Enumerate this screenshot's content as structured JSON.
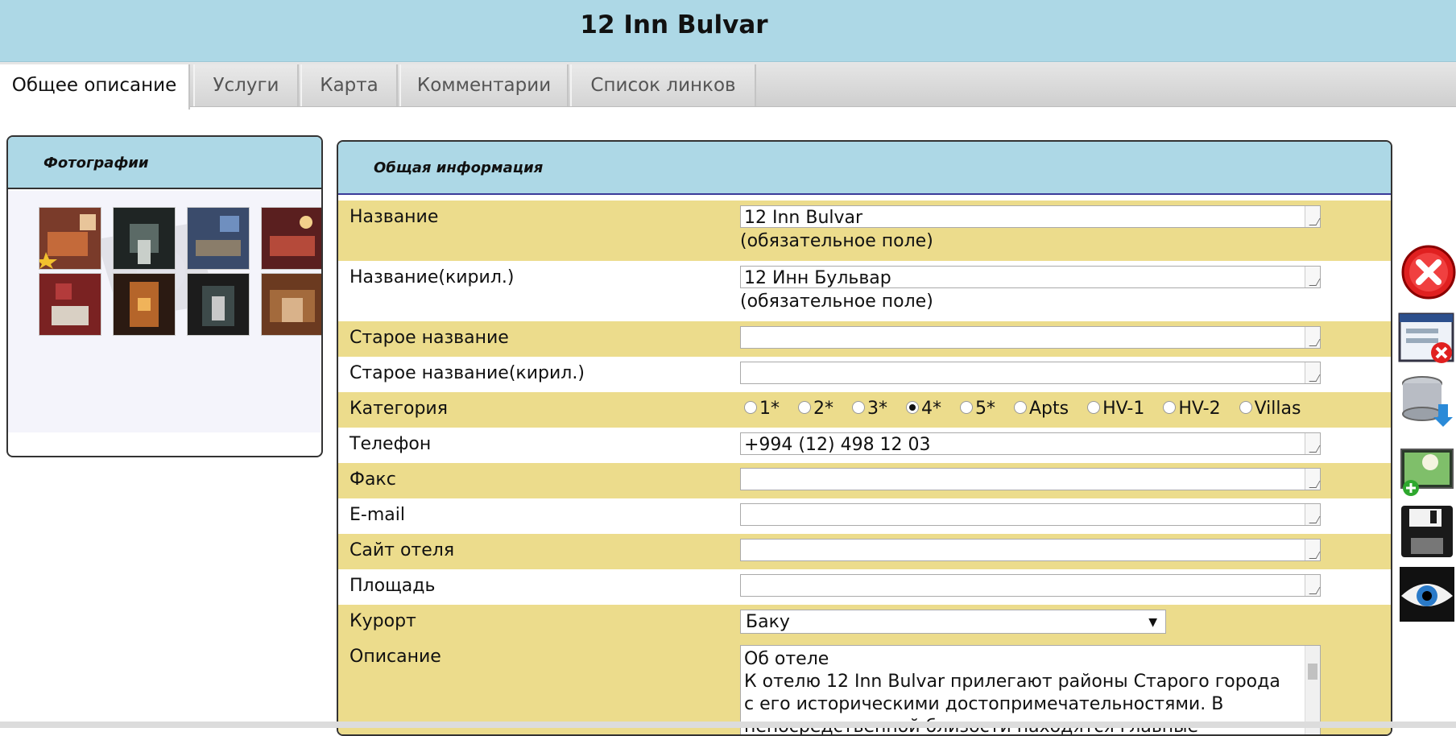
{
  "header": {
    "title": "12 Inn Bulvar"
  },
  "tabs": [
    {
      "label": "Общее описание",
      "active": true
    },
    {
      "label": "Услуги",
      "active": false
    },
    {
      "label": "Карта",
      "active": false
    },
    {
      "label": "Комментарии",
      "active": false
    },
    {
      "label": "Список линков",
      "active": false
    }
  ],
  "photos_panel": {
    "title": "Фотографии",
    "thumbnails": [
      "photo-1",
      "photo-2",
      "photo-3",
      "photo-4",
      "photo-5",
      "photo-6",
      "photo-7",
      "photo-8"
    ]
  },
  "info_panel": {
    "title": "Общая информация",
    "fields": {
      "name": {
        "label": "Название",
        "value": "12 Inn Bulvar",
        "note": "(обязательное поле)"
      },
      "name_cyr": {
        "label": "Название(кирил.)",
        "value": "12 Инн Бульвар",
        "note": "(обязательное поле)"
      },
      "old_name": {
        "label": "Старое название",
        "value": ""
      },
      "old_name_cyr": {
        "label": "Старое название(кирил.)",
        "value": ""
      },
      "category": {
        "label": "Категория",
        "options": [
          "1*",
          "2*",
          "3*",
          "4*",
          "5*",
          "Apts",
          "HV-1",
          "HV-2",
          "Villas"
        ],
        "selected": "4*"
      },
      "phone": {
        "label": "Телефон",
        "value": "+994 (12) 498 12 03"
      },
      "fax": {
        "label": "Факс",
        "value": ""
      },
      "email": {
        "label": "E-mail",
        "value": ""
      },
      "site": {
        "label": "Сайт отеля",
        "value": ""
      },
      "area": {
        "label": "Площадь",
        "value": ""
      },
      "resort": {
        "label": "Курорт",
        "value": "Баку"
      },
      "description": {
        "label": "Описание",
        "line1": "Об отеле",
        "line2": "К отелю 12 Inn Bulvar прилегают районы Старого города",
        "line3": "с его историческими достопримечательностями. В",
        "line4": "непосредственной близости находятся главные"
      }
    }
  },
  "toolbar_icons": [
    "close-icon",
    "delete-list-icon",
    "database-download-icon",
    "add-image-icon",
    "save-floppy-icon",
    "preview-eye-icon"
  ],
  "colors": {
    "header_bg": "#add8e6",
    "row_alt": "#ecdc8c"
  }
}
